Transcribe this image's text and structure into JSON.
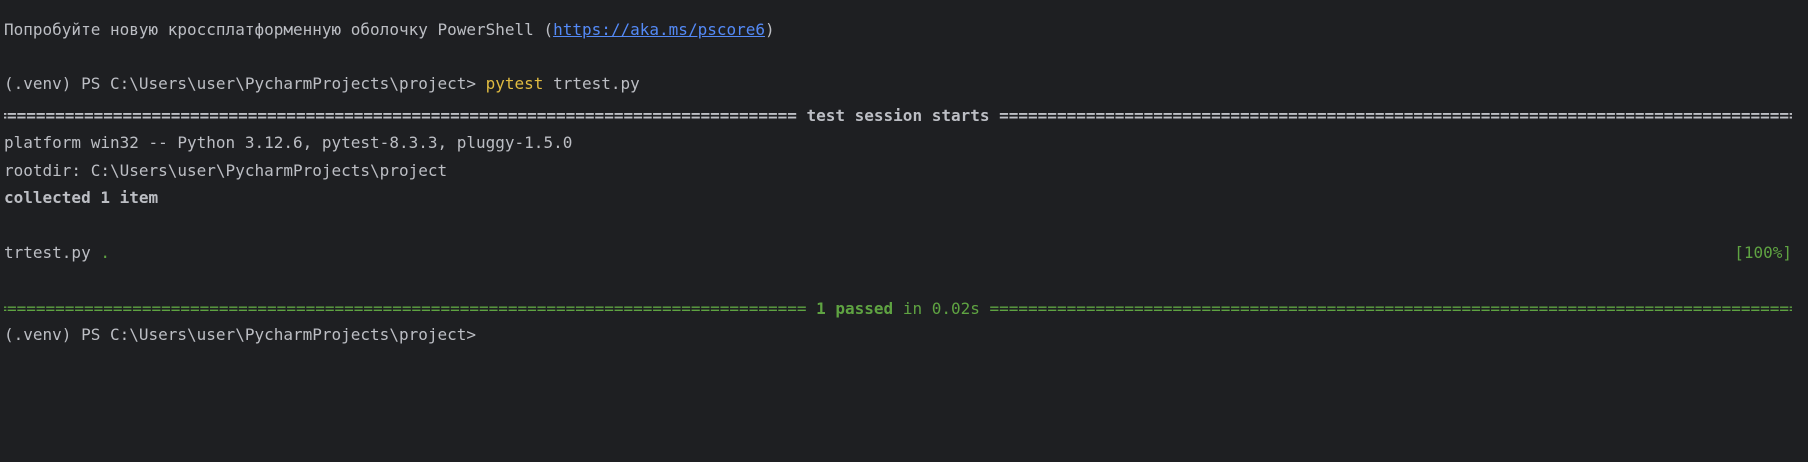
{
  "banner": {
    "prefix": "Попробуйте новую кроссплатформенную оболочку PowerShell (",
    "link": "https://aka.ms/pscore6",
    "suffix": ")"
  },
  "prompt_1": {
    "prompt": "(.venv) PS C:\\Users\\user\\PycharmProjects\\project> ",
    "command": "pytest",
    "args": " trtest.py"
  },
  "session_header": {
    "title": " test session starts "
  },
  "platform_line": "platform win32 -- Python 3.12.6, pytest-8.3.3, pluggy-1.5.0",
  "rootdir_line": "rootdir: C:\\Users\\user\\PycharmProjects\\project",
  "collected_line": "collected 1 item",
  "result_line": {
    "file": "trtest.py",
    "dot": " .",
    "percent": "[100%]"
  },
  "summary": {
    "passed": " 1 passed",
    "time": " in 0.02s "
  },
  "prompt_2": {
    "prompt": "(.venv) PS C:\\Users\\user\\PycharmProjects\\project>"
  },
  "colors": {
    "background": "#1e1f22",
    "text": "#bcbec4",
    "link": "#548af7",
    "command": "#e0bb41",
    "success": "#5fa342"
  }
}
